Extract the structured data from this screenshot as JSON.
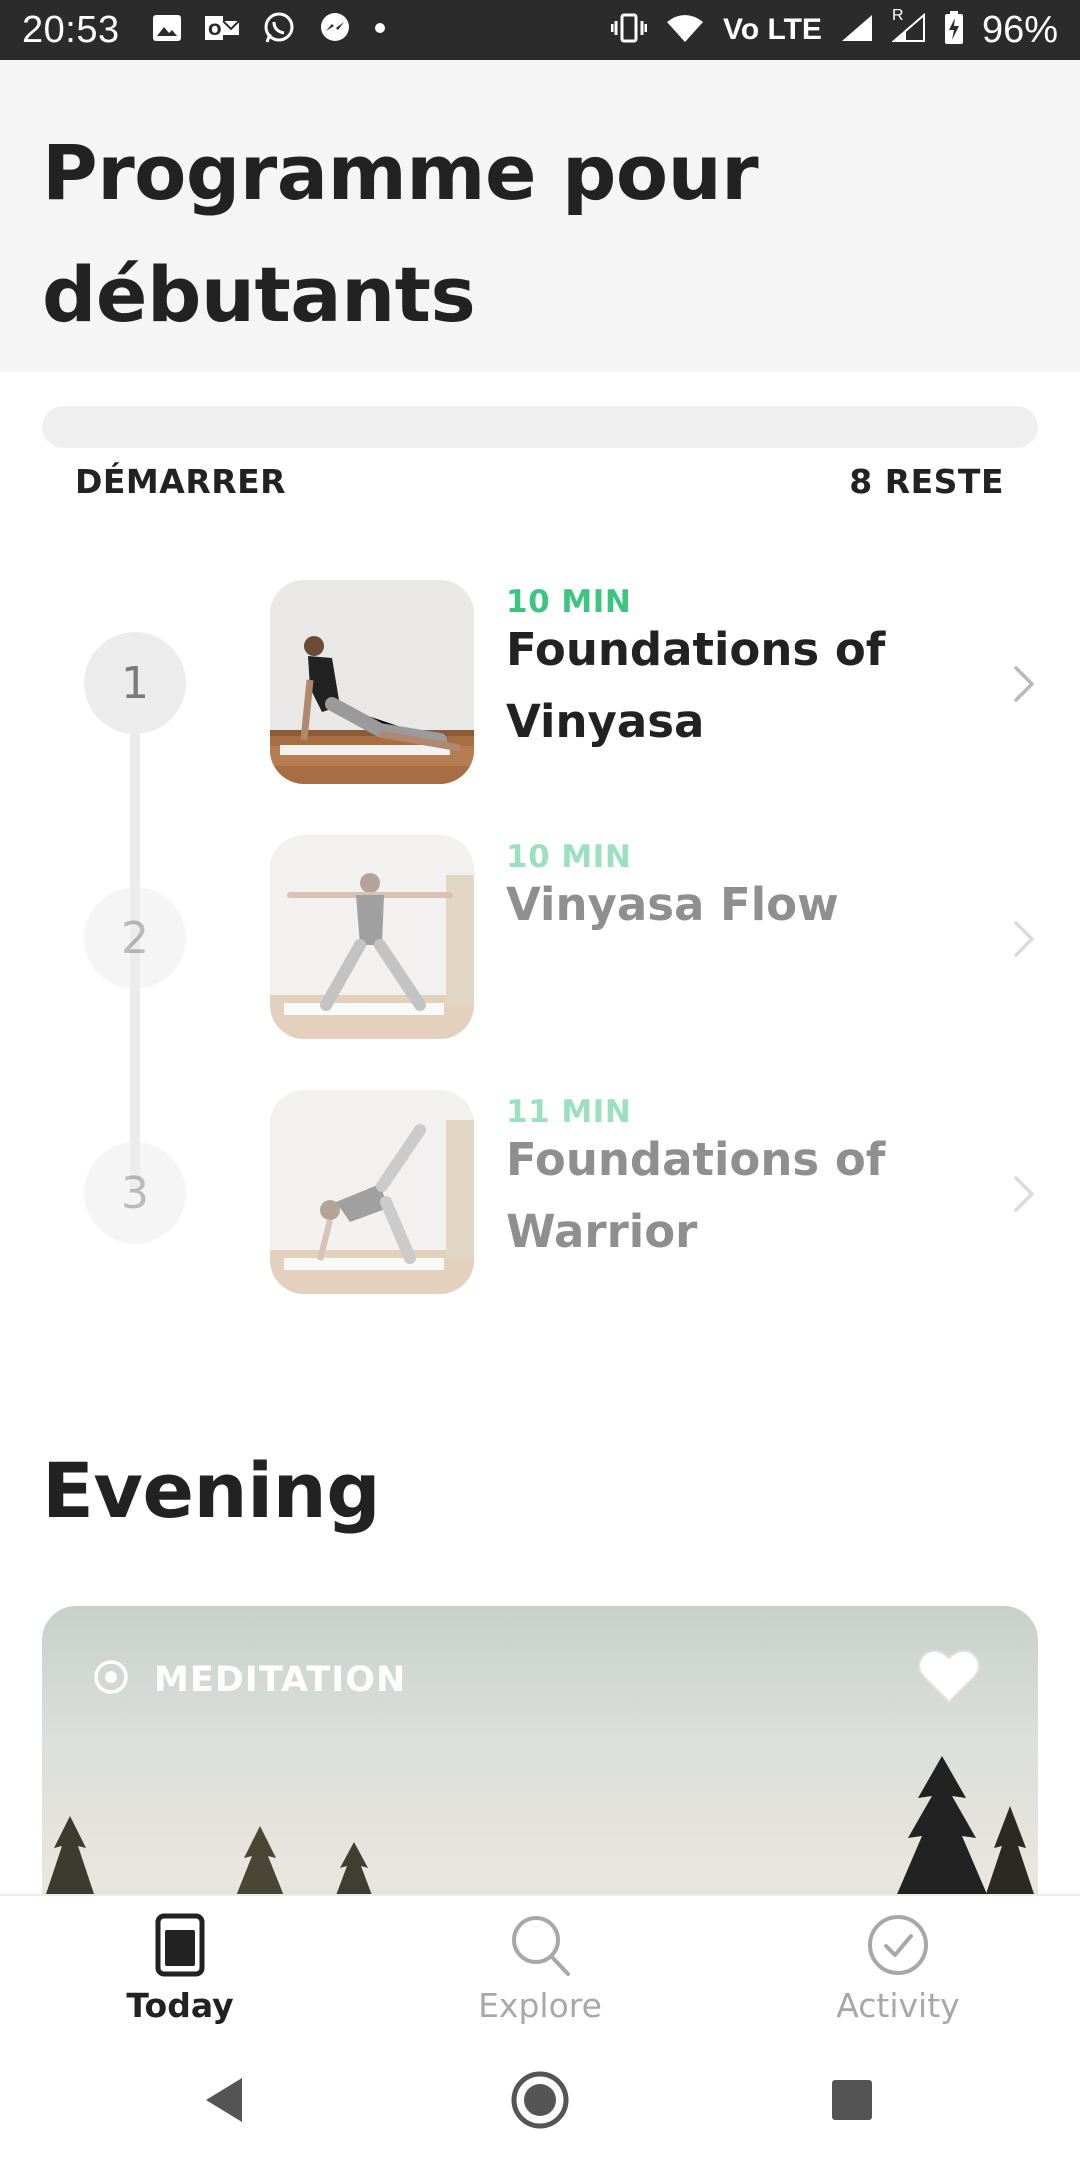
{
  "status_bar": {
    "time": "20:53",
    "battery": "96%",
    "left_icons": [
      "image-icon",
      "outlook-icon",
      "whatsapp-icon",
      "messenger-icon",
      "dot-icon"
    ],
    "right_icons": [
      "vibrate-icon",
      "wifi-icon",
      "volte-icon",
      "signal-icon",
      "signal-roaming-icon",
      "battery-charging-icon"
    ],
    "volte_label": "Vo LTE",
    "roaming_label": "R"
  },
  "header": {
    "title": "Programme pour débutants"
  },
  "progress": {
    "start_label": "DÉMARRER",
    "remaining_label": "8 RESTE",
    "completed_fraction": 0.0,
    "fill_color": "#3cc481"
  },
  "steps": [
    {
      "number": "1",
      "duration": "10 MIN",
      "title": "Foundations of Vinyasa",
      "state": "current"
    },
    {
      "number": "2",
      "duration": "10 MIN",
      "title": "Vinyasa Flow",
      "state": "locked"
    },
    {
      "number": "3",
      "duration": "11 MIN",
      "title": "Foundations of Warrior",
      "state": "locked"
    }
  ],
  "section": {
    "title": "Evening"
  },
  "card": {
    "category": "MEDITATION",
    "category_icon": "target-icon",
    "favorite_icon": "heart-icon"
  },
  "bottom_nav": {
    "items": [
      {
        "label": "Today",
        "icon": "today-icon",
        "active": true
      },
      {
        "label": "Explore",
        "icon": "search-icon",
        "active": false
      },
      {
        "label": "Activity",
        "icon": "check-circle-icon",
        "active": false
      }
    ]
  },
  "system_nav": {
    "buttons": [
      "back-icon",
      "home-icon",
      "recents-icon"
    ]
  },
  "colors": {
    "accent": "#3cc481",
    "text": "#222222",
    "muted": "#a8a8a8",
    "header_bg": "#f5f5f5"
  }
}
